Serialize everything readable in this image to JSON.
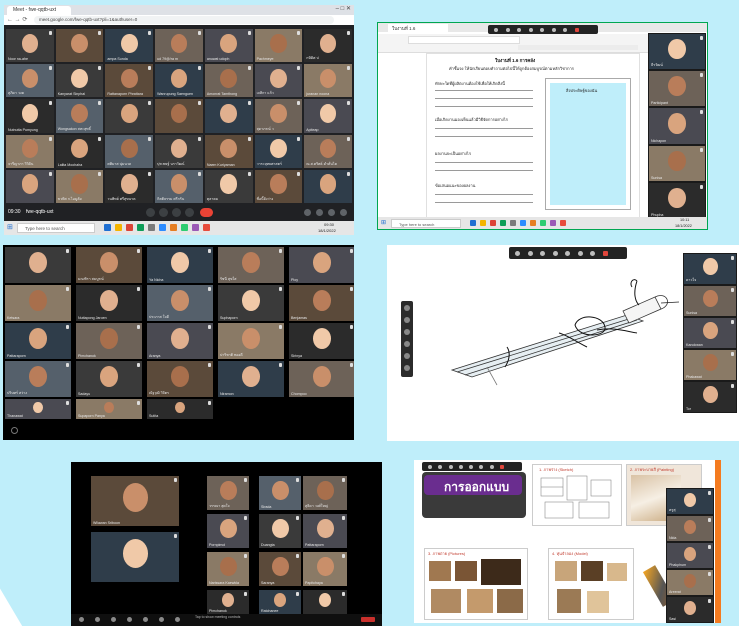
{
  "colors": {
    "background_shape": "#bfeefa",
    "meet_bg": "#202124",
    "end_call": "#ea4335",
    "zoom_bg": "#000000",
    "slide_title_bg": "#6a2d8f",
    "slide_title_text": "#ffffff"
  },
  "panel1": {
    "tab_title": "Meet - fwe-qqtb-uxt",
    "url": "meet.google.com/fwe-qqtb-uxt?pli=1&authuser=0",
    "participants": [
      "Noor na-ahe",
      "",
      "ampa Sunda",
      "ud 79@/ra m",
      "anuwat udoph",
      "Pachmeye",
      "กษิดิศ ป",
      "สุภิดา วงค",
      "Kanyarat Sinphai",
      "Rattanaporn Phrattara",
      "Wanrupung Saenguen",
      "Amonrat Tamthong",
      "เจสิกา แก้ว",
      "juranan noona",
      "Nutnutta Pumyung",
      "Wongsakon สหะสุทธิ์",
      "",
      "",
      "",
      "สุดาภรณ์ ว",
      "Apiteap",
      "จารีญาภา วิวิดิน",
      "Lalita Moohaha",
      "ศศิมาส นุ่มนวล",
      "ปุรเชษฐ์ นราวัฒน์",
      "Naem Kuriyaman",
      "วาระยุทธศาสตร์",
      "ณ.ส.คริศธ์ ดำคั่นไค",
      "",
      "ขวพิส ก.ไอมูลัย",
      "วนพิทย์ ศรีสุขนาค",
      "กิตติธรรม ศรีกรัน",
      "ตุลาคม",
      "ชื่อนี้ยังว่าง",
      ""
    ],
    "time": "09:30",
    "meeting_code": "fwe-qqtb-uxt",
    "taskbar_search": "Type here to search",
    "clock_time": "09:30",
    "clock_date": "18/1/2022"
  },
  "panel2": {
    "tab_title": "ใบงานที่ 1.6",
    "worksheet_title": "ใบงานที่ 1.6 การคลัง",
    "instruction": "คำชี้แจง ให้นักเรียนตอบคำถามต่อไปนี้ให้ถูกต้องสมบูรณ์ตามหลักวิชาการ",
    "q1": "ทักษะใดที่ผู้ผลิตงานต้องใช้เพื่อให้เกิดสิ่งนี้",
    "q2": "เมื่อเกิดงานมองเห็นแล้วมีวิธีจัดการอย่างไร",
    "q3": "ผลงานจะเป็นอย่างไร",
    "q4": "ข้อเสนอแนะของผลงาน",
    "box_title": "สิ่งประดิษฐ์ของฉัน",
    "taskbar_search": "Type here to search",
    "clock_time": "10:11",
    "clock_date": "18/1/2022",
    "participants": [
      "ธีรวัฒน์",
      "Participant",
      "Nichapon",
      "Sunisa",
      "Phupha"
    ]
  },
  "panel3": {
    "participants": [
      "",
      "มณฑิรา สมบูรณ์",
      "Ya Nicha",
      "รัชนี สุขใส",
      "Ploy",
      "Ketsara",
      "Nuttapong Jaroen",
      "ประภาส ใจดี",
      "Suphaporn",
      "Benjamas",
      "Pattaraporn",
      "Pimchanok",
      "Aranya",
      "ปาริชาติ ทองดี",
      "Sirinya",
      "ปรินทร์ สว่าง",
      "Sadayu",
      "ณัฐวุฒิ วิจิตร",
      "Niramon",
      "Chompoo",
      "Thanawat",
      "Supaporn Panya",
      "Sutita"
    ]
  },
  "panel4": {
    "participants": [
      "ดาวใจ",
      "Sunisa",
      "Kanokwan",
      "Phakawat",
      "Tor"
    ]
  },
  "panel5": {
    "participants": [
      "Wilawan Sriboon",
      "",
      "วรรณา สุดใจ",
      "Pornpimol",
      "Narissara Kaewkla",
      "Pimchanok",
      "Sirada",
      "Duangta",
      "Saranya",
      "Ratchanee",
      "สุธิดา วงศ์ใหญ่",
      "Pattaraporn",
      "Papitchaya",
      ""
    ],
    "footer": "Tap to show meeting controls"
  },
  "panel6": {
    "slide_title": "การออกแบบ",
    "label_sketch": "1. ภาพร่าง (Sketch)",
    "label_painting": "2. ภาพระบายสี (Painting)",
    "label_pictures": "3. ภาพถ่าย (Pictures)",
    "label_model": "4. หุ่นจำลอง (Model)",
    "participants": [
      "ครูสุ",
      "Nida",
      "Phakphum",
      "Areerat",
      "Sasi"
    ]
  }
}
